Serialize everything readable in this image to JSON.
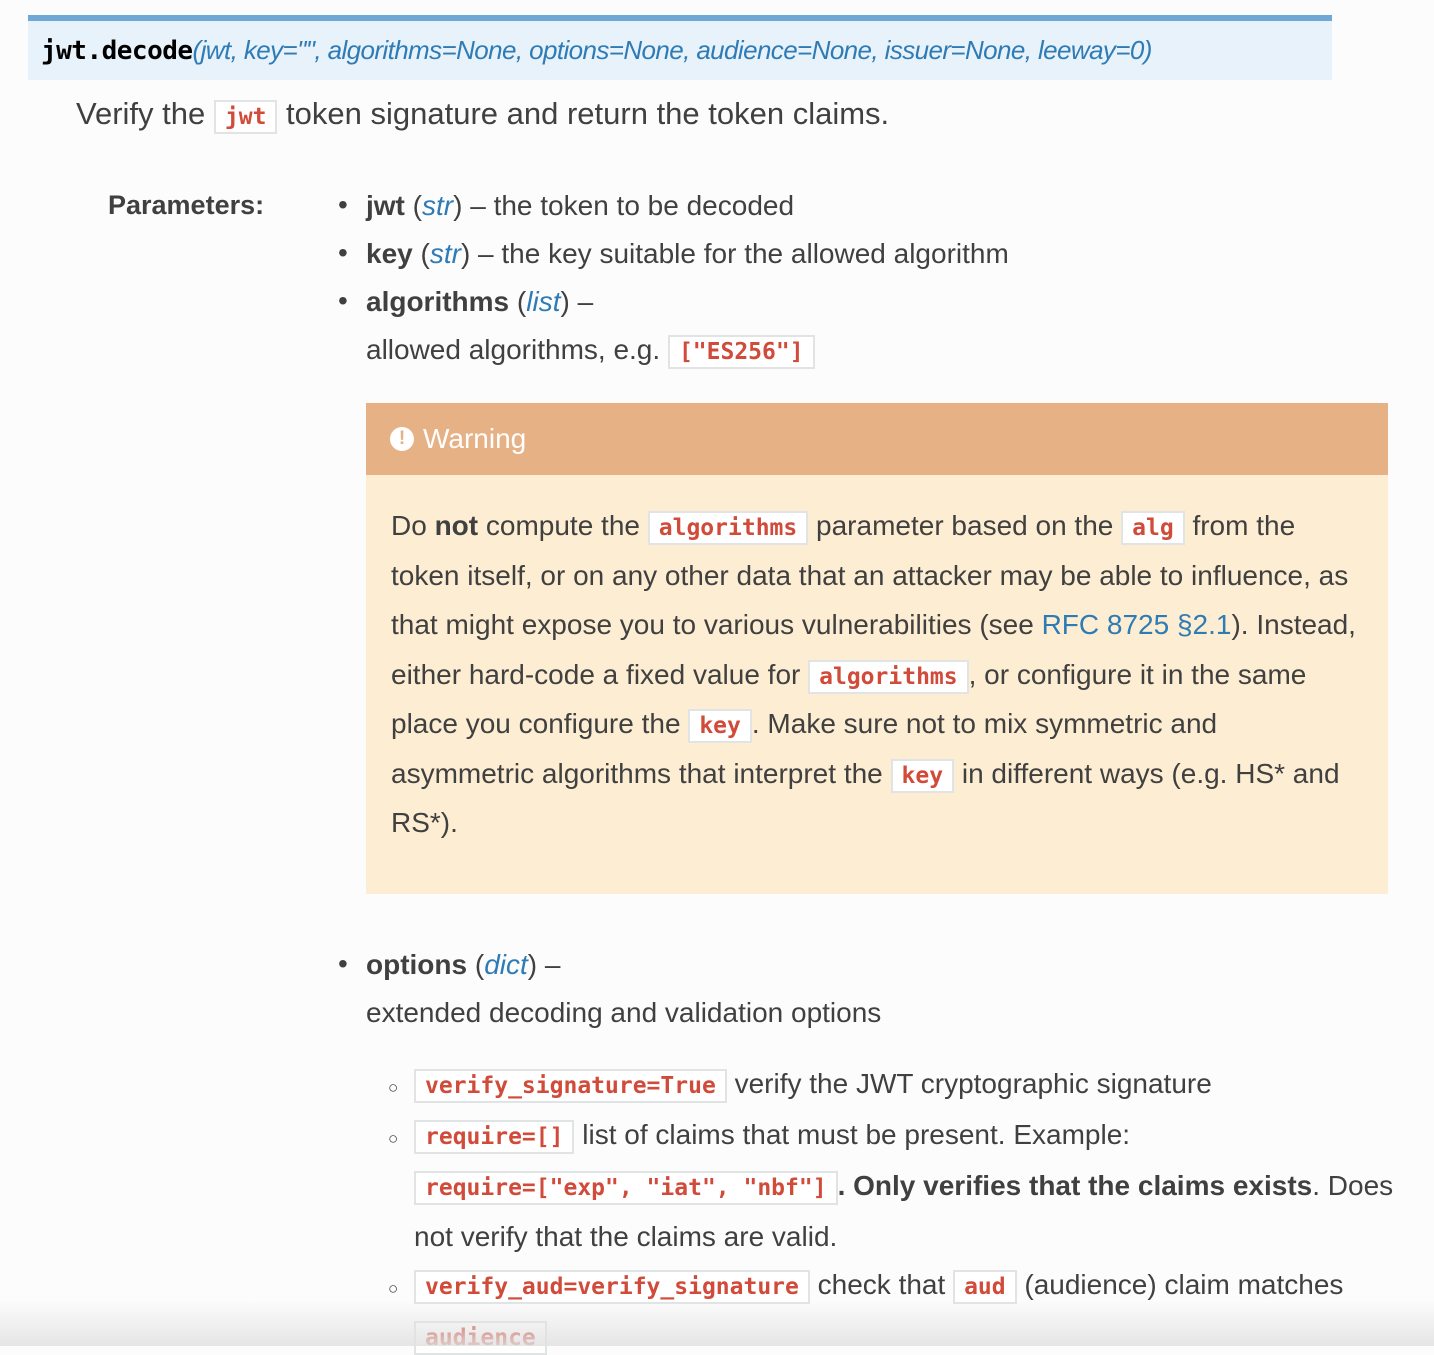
{
  "signature": {
    "name": "jwt.decode",
    "params": "(jwt, key=\"\", algorithms=None, options=None, audience=None, issuer=None, leeway=0)"
  },
  "description": {
    "before": "Verify the",
    "code": "jwt",
    "after": "token signature and return the token claims."
  },
  "parameters_label": "Parameters:",
  "parameters": [
    {
      "name": "jwt",
      "type": "str",
      "desc": " – the token to be decoded"
    },
    {
      "name": "key",
      "type": "str",
      "desc": " – the key suitable for the allowed algorithm"
    },
    {
      "name": "algorithms",
      "type": "list",
      "desc": " –",
      "desc2": "allowed algorithms, e.g.",
      "example": "[\"ES256\"]"
    },
    {
      "name": "options",
      "type": "dict",
      "desc": " –",
      "desc2": "extended decoding and validation options"
    }
  ],
  "warning": {
    "icon": "exclamation-circle-icon",
    "title": "Warning",
    "lines": {
      "l1a": "Do ",
      "l1b": "not",
      "l1c": " compute the ",
      "l1code1": "algorithms",
      "l1d": " parameter based on the ",
      "l1code2": "alg",
      "l1e": " from the",
      "l2": "token itself, or on any other data that an attacker may be able to influence, as",
      "l3a": "that might expose you to various vulnerabilities (see ",
      "l3link": "RFC 8725 §2.1",
      "l3b": "). Instead,",
      "l4a": "either hard-code a fixed value for ",
      "l4code": "algorithms",
      "l4b": ", or configure it in the same",
      "l5a": "place you configure the ",
      "l5code": "key",
      "l5b": ". Make sure not to mix symmetric and",
      "l6a": "asymmetric algorithms that interpret the ",
      "l6code": "key",
      "l6b": " in different ways (e.g. HS* and",
      "l7": "RS*)."
    }
  },
  "options": [
    {
      "code": "verify_signature=True",
      "desc": " verify the JWT cryptographic signature"
    },
    {
      "code": "require=[]",
      "desc": " list of claims that must be present. Example:",
      "code2": "require=[\"exp\", \"iat\", \"nbf\"]",
      "bold": ". Only verifies that the claims exists",
      "desc2": ". Does",
      "desc3": "not verify that the claims are valid."
    },
    {
      "code": "verify_aud=verify_signature",
      "desc": " check that ",
      "code2": "aud",
      "desc2": " (audience) claim matches",
      "code3": "audience"
    }
  ]
}
